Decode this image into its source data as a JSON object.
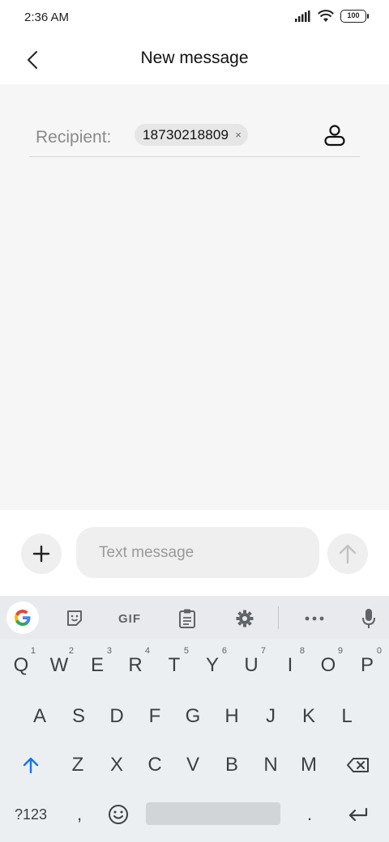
{
  "status_bar": {
    "time": "2:36 AM",
    "battery": "100"
  },
  "header": {
    "title": "New message"
  },
  "recipient": {
    "label": "Recipient:",
    "chip_number": "18730218809",
    "chip_close": "×"
  },
  "compose": {
    "placeholder": "Text message"
  },
  "keyboard": {
    "toolbar": {
      "gif_label": "GIF"
    },
    "row1": [
      {
        "key": "Q",
        "hint": "1"
      },
      {
        "key": "W",
        "hint": "2"
      },
      {
        "key": "E",
        "hint": "3"
      },
      {
        "key": "R",
        "hint": "4"
      },
      {
        "key": "T",
        "hint": "5"
      },
      {
        "key": "Y",
        "hint": "6"
      },
      {
        "key": "U",
        "hint": "7"
      },
      {
        "key": "I",
        "hint": "8"
      },
      {
        "key": "O",
        "hint": "9"
      },
      {
        "key": "P",
        "hint": "0"
      }
    ],
    "row2": [
      "A",
      "S",
      "D",
      "F",
      "G",
      "H",
      "J",
      "K",
      "L"
    ],
    "row3": [
      "Z",
      "X",
      "C",
      "V",
      "B",
      "N",
      "M"
    ],
    "row4": {
      "symbols": "?123",
      "comma": ",",
      "period": "."
    }
  },
  "colors": {
    "accent_blue": "#1a73e8",
    "content_bg": "#f6f6f6",
    "keyboard_bg": "#eceff1"
  }
}
